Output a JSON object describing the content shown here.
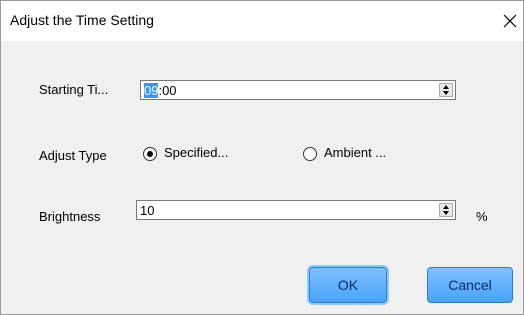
{
  "window": {
    "title": "Adjust the Time Setting"
  },
  "starting_time": {
    "label": "Starting Ti...",
    "hour_selected": "09",
    "rest": ":00"
  },
  "adjust_type": {
    "label": "Adjust Type",
    "options": [
      {
        "label": "Specified...",
        "checked": true
      },
      {
        "label": "Ambient ...",
        "checked": false
      }
    ]
  },
  "brightness": {
    "label": "Brightness",
    "value": "10",
    "unit": "%"
  },
  "buttons": {
    "ok": "OK",
    "cancel": "Cancel"
  }
}
